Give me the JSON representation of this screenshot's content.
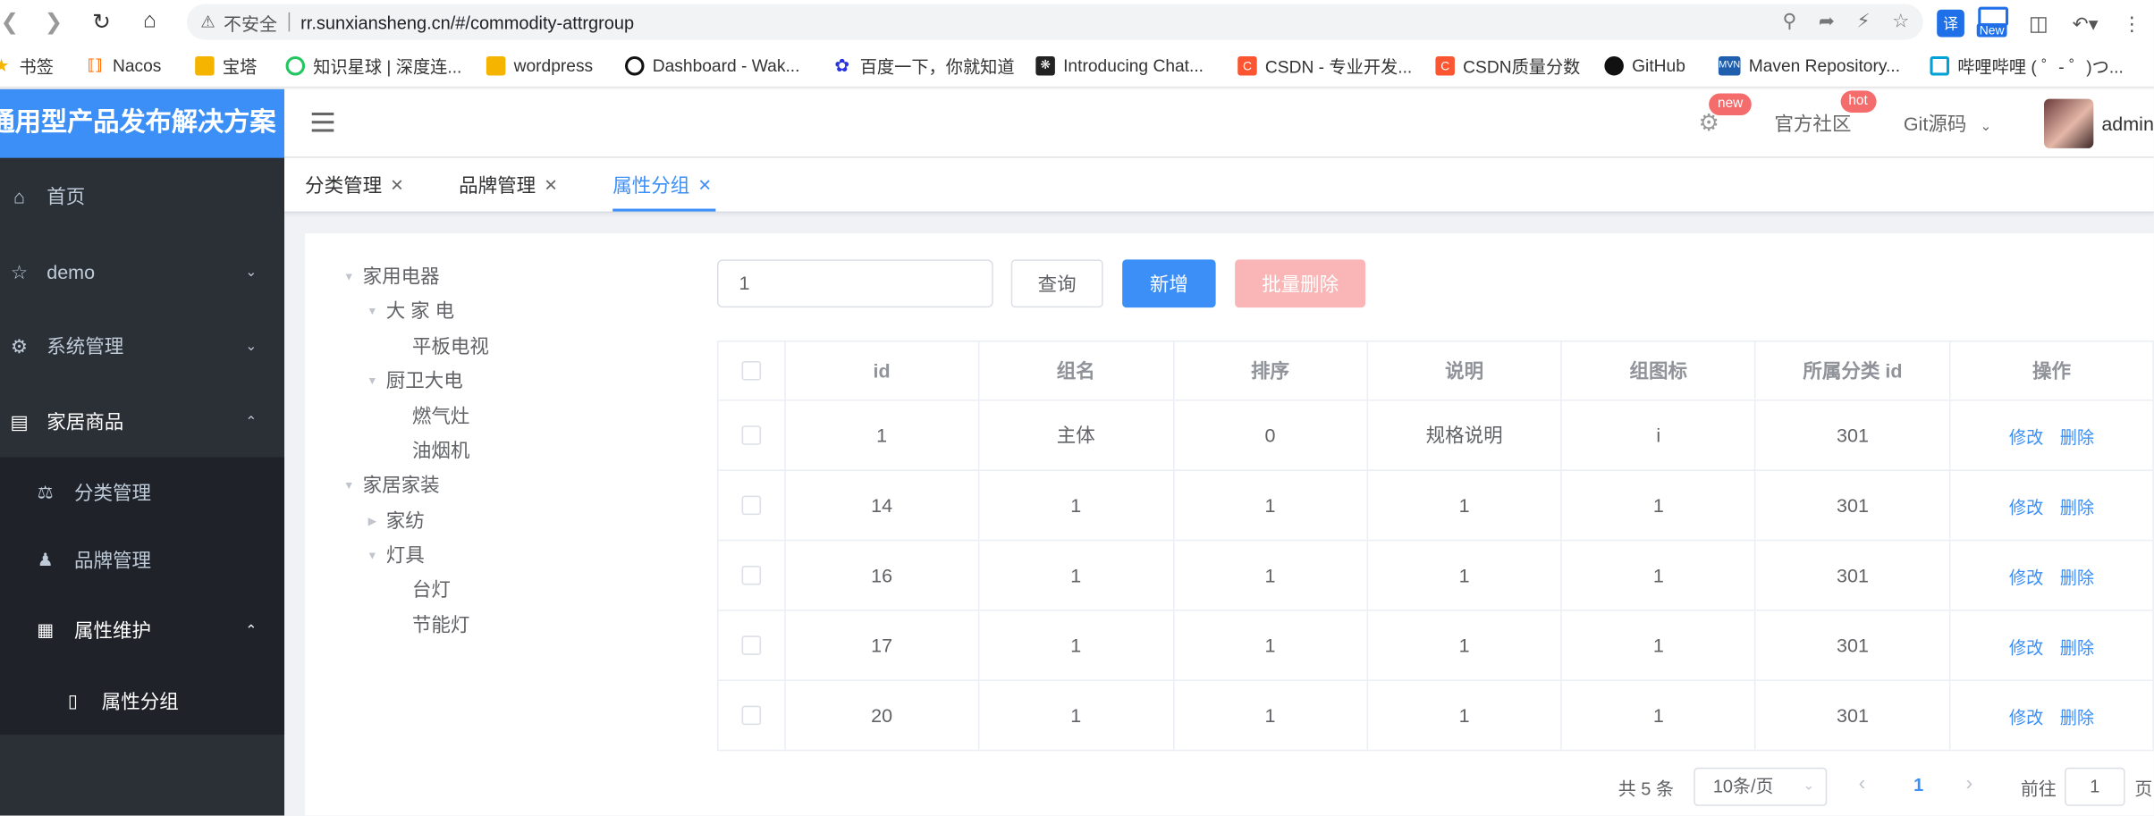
{
  "browser": {
    "insecure_label": "不安全",
    "url": "rr.sunxiansheng.cn/#/commodity-attrgroup",
    "bookmarks": [
      {
        "icon": "star-icon",
        "label": "书签",
        "color": "#f5b400"
      },
      {
        "icon": "nacos-icon",
        "label": "Nacos",
        "color": "#ff6a00"
      },
      {
        "icon": "folder-icon",
        "label": "宝塔",
        "color": "#f5b400"
      },
      {
        "icon": "zsxq-icon",
        "label": "知识星球 | 深度连...",
        "color": "#22c55e"
      },
      {
        "icon": "folder-icon",
        "label": "wordpress",
        "color": "#f5b400"
      },
      {
        "icon": "github-circle-icon",
        "label": "Dashboard - Wak...",
        "color": "#111111"
      },
      {
        "icon": "baidu-icon",
        "label": "百度一下，你就知道",
        "color": "#2932e1"
      },
      {
        "icon": "chatgpt-icon",
        "label": "Introducing Chat...",
        "color": "#222222"
      },
      {
        "icon": "csdn-icon",
        "label": "CSDN - 专业开发...",
        "color": "#fc5531"
      },
      {
        "icon": "csdn-icon",
        "label": "CSDN质量分数",
        "color": "#fc5531"
      },
      {
        "icon": "github-icon",
        "label": "GitHub",
        "color": "#111111"
      },
      {
        "icon": "maven-icon",
        "label": "Maven Repository...",
        "color": "#1f5fad"
      },
      {
        "icon": "bilibili-icon",
        "label": "哔哩哔哩 ( ゜- ゜)つ...",
        "color": "#00a1d6"
      }
    ],
    "ext_translate": "译",
    "ext_new": "New"
  },
  "app": {
    "logo_text": "通用型产品发布解决方案",
    "menu": {
      "home": "首页",
      "demo": "demo",
      "system": "系统管理",
      "home_goods": "家居商品",
      "category": "分类管理",
      "brand": "品牌管理",
      "attr_maint": "属性维护",
      "attr_group": "属性分组"
    },
    "navbar": {
      "badge_new": "new",
      "community": "官方社区",
      "badge_hot": "hot",
      "git": "Git源码",
      "user": "admin"
    },
    "tags": [
      {
        "label": "分类管理",
        "active": false
      },
      {
        "label": "品牌管理",
        "active": false
      },
      {
        "label": "属性分组",
        "active": true
      }
    ]
  },
  "tree": [
    {
      "label": "家用电器",
      "level": 0,
      "caret": "open"
    },
    {
      "label": "大 家 电",
      "level": 1,
      "caret": "open"
    },
    {
      "label": "平板电视",
      "level": 2,
      "caret": "none"
    },
    {
      "label": "厨卫大电",
      "level": 1,
      "caret": "open"
    },
    {
      "label": "燃气灶",
      "level": 2,
      "caret": "none"
    },
    {
      "label": "油烟机",
      "level": 2,
      "caret": "none"
    },
    {
      "label": "家居家装",
      "level": 0,
      "caret": "open"
    },
    {
      "label": "家纺",
      "level": 1,
      "caret": "closed"
    },
    {
      "label": "灯具",
      "level": 1,
      "caret": "open"
    },
    {
      "label": "台灯",
      "level": 2,
      "caret": "none"
    },
    {
      "label": "节能灯",
      "level": 2,
      "caret": "none"
    }
  ],
  "toolbar": {
    "search_value": "1",
    "query": "查询",
    "add": "新增",
    "batch_delete": "批量删除"
  },
  "table": {
    "columns": [
      "id",
      "组名",
      "排序",
      "说明",
      "组图标",
      "所属分类 id",
      "操作"
    ],
    "rows": [
      [
        "1",
        "主体",
        "0",
        "规格说明",
        "i",
        "301"
      ],
      [
        "14",
        "1",
        "1",
        "1",
        "1",
        "301"
      ],
      [
        "16",
        "1",
        "1",
        "1",
        "1",
        "301"
      ],
      [
        "17",
        "1",
        "1",
        "1",
        "1",
        "301"
      ],
      [
        "20",
        "1",
        "1",
        "1",
        "1",
        "301"
      ]
    ],
    "edit": "修改",
    "delete": "删除"
  },
  "pagination": {
    "total": "共 5 条",
    "page_size": "10条/页",
    "current": "1",
    "goto_prefix": "前往",
    "goto_value": "1",
    "goto_suffix": "页"
  },
  "colors": {
    "primary": "#3b8ff6",
    "sidebar": "#2b2f36",
    "danger_light": "#fab6b6"
  }
}
